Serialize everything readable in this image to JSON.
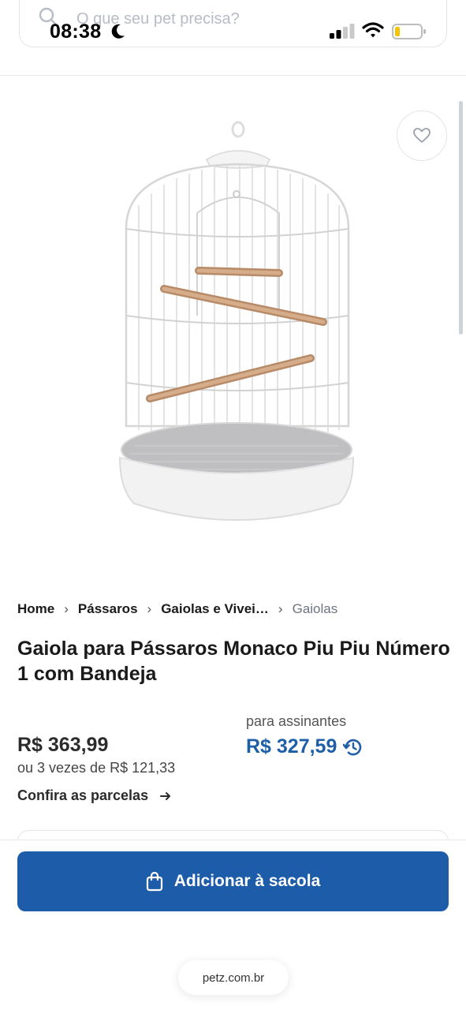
{
  "status_bar": {
    "time": "08:38"
  },
  "search": {
    "placeholder": "O que seu pet precisa?"
  },
  "breadcrumb": [
    "Home",
    "Pássaros",
    "Gaiolas e Vivei…",
    "Gaiolas"
  ],
  "product": {
    "title": "Gaiola para Pássaros Monaco Piu Piu Número 1 com Bandeja",
    "price": "R$ 363,99",
    "installments": "ou 3 vezes de R$ 121,33",
    "parcelas_link": "Confira as parcelas",
    "subscriber_label": "para assinantes",
    "subscriber_price": "R$ 327,59"
  },
  "actions": {
    "add_to_bag": "Adicionar à sacola"
  },
  "browser": {
    "url": "petz.com.br"
  },
  "colors": {
    "primary": "#1c5ca8",
    "subscriber_price": "#1f5fa8"
  }
}
